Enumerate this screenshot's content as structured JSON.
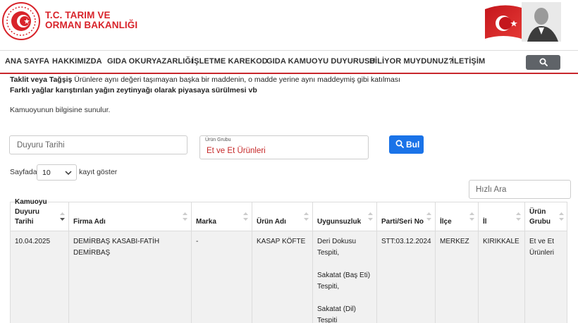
{
  "brand": {
    "line1": "T.C. TARIM VE",
    "line2": "ORMAN BAKANLIĞI"
  },
  "nav": {
    "items": [
      "ANA SAYFA",
      "HAKKIMIZDA",
      "GIDA OKURYAZARLIĞI",
      "İŞLETME KAREKOD",
      "GIDA KAMUOYU DUYURUSU",
      "BİLİYOR MUYDUNUZ?",
      "İLETİŞİM"
    ]
  },
  "intro": {
    "bold1": "Taklit veya Tağşiş",
    "rest1": " Ürünlere aynı değeri taşımayan başka bir maddenin, o madde yerine aynı maddeymiş gibi katılması",
    "line2": "Farklı yağlar karıştırılan yağın zeytinyağı olarak piyasaya sürülmesi vb"
  },
  "notice": "Kamuoyunun bilgisine sunulur.",
  "filters": {
    "date_placeholder": "Duyuru Tarihi",
    "group_label": "Ürün Grubu",
    "group_value": "Et ve Et Ürünleri",
    "search_button": "Bul"
  },
  "length": {
    "before": "Sayfada",
    "value": "10",
    "after": "kayıt göster"
  },
  "quick_search_placeholder": "Hızlı Ara",
  "table": {
    "headers": [
      "Kamuoyu Duyuru Tarihi",
      "Firma Adı",
      "Marka",
      "Ürün Adı",
      "Uygunsuzluk",
      "Parti/Seri No",
      "İlçe",
      "İl",
      "Ürün Grubu"
    ],
    "row": {
      "date": "10.04.2025",
      "firm": "DEMİRBAŞ KASABI-FATİH DEMİRBAŞ",
      "brand": "-",
      "product": "KASAP KÖFTE",
      "issue1a": "Deri Dokusu",
      "issue1b": "Tespiti,",
      "issue2a": "Sakatat (Baş Eti)",
      "issue2b": "Tespiti,",
      "issue3a": "Sakatat (Dil)",
      "issue3b": "Tespiti",
      "batch": "STT:03.12.2024",
      "district": "MERKEZ",
      "province": "KIRIKKALE",
      "group1": "Et ve Et",
      "group2": "Ürünleri"
    }
  },
  "colors": {
    "brand_red": "#d8232a",
    "button_blue": "#1a73e8",
    "nav_search": "#5f6368"
  }
}
